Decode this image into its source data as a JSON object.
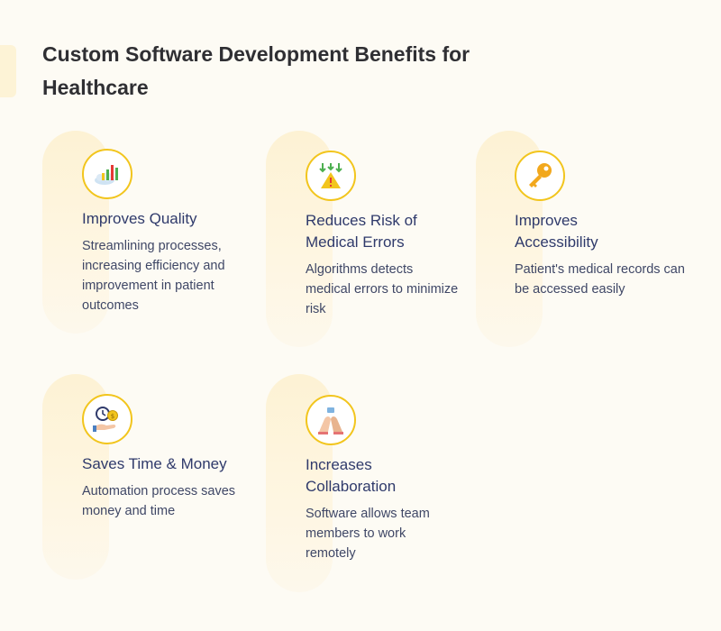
{
  "title": "Custom Software Development Benefits for Healthcare",
  "colors": {
    "accent": "#f2c51d",
    "heading": "#2f3a6b",
    "text": "#3f4766",
    "background": "#fdfbf4"
  },
  "benefits": [
    {
      "icon": "quality-chart-icon",
      "title": "Improves Quality",
      "description": "Streamlining processes, increasing efficiency and improvement in patient outcomes"
    },
    {
      "icon": "warning-arrows-icon",
      "title": "Reduces Risk of Medical Errors",
      "description": "Algorithms detects medical errors to minimize risk"
    },
    {
      "icon": "key-icon",
      "title": "Improves Accessibility",
      "description": "Patient's medical records can be accessed easily"
    },
    {
      "icon": "clock-coin-hand-icon",
      "title": "Saves Time & Money",
      "description": "Automation process saves money and time"
    },
    {
      "icon": "collaboration-hands-icon",
      "title": "Increases Collaboration",
      "description": "Software allows team members to work remotely"
    }
  ]
}
